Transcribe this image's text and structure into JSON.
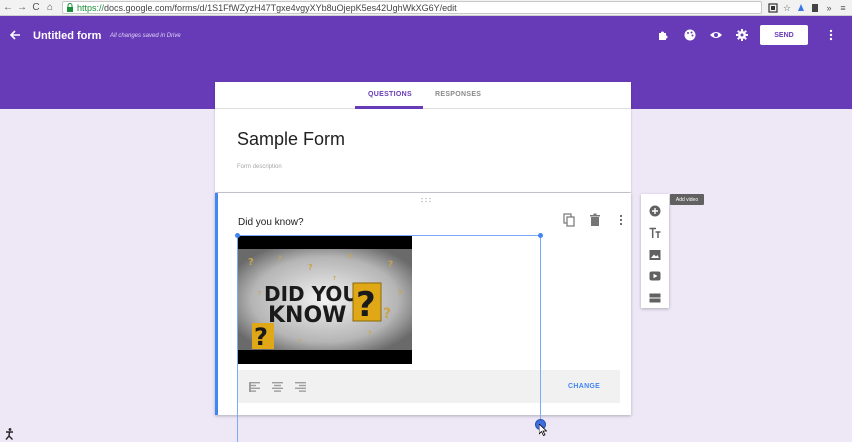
{
  "browser": {
    "url_https": "https://",
    "url_rest": "docs.google.com/forms/d/1S1FfWZyzH47Tgxe4vgyXYb8uOjepK5es42UghWkXG6Y/edit",
    "nav_back": "←",
    "nav_forward": "→",
    "nav_reload": "C",
    "nav_home": "⌂",
    "ext_icons": [
      "screenshot-icon",
      "star-icon",
      "extension-icon",
      "pocket-icon",
      "more-extensions-icon",
      "menu-icon"
    ]
  },
  "header": {
    "title": "Untitled form",
    "saved_note": "All changes saved in Drive",
    "send_label": "SEND",
    "icons": [
      "addon-icon",
      "palette-icon",
      "preview-eye-icon",
      "settings-gear-icon"
    ]
  },
  "tabs": {
    "questions": "QUESTIONS",
    "responses": "RESPONSES",
    "active": "questions"
  },
  "form": {
    "title": "Sample Form",
    "description_placeholder": "Form description"
  },
  "question": {
    "title": "Did you know?",
    "video_text_line1": "DID YOU",
    "video_text_line2": "KNOW",
    "change_label": "CHANGE"
  },
  "side_toolbar": {
    "tooltip": "Add video",
    "items": [
      "add-question-icon",
      "add-title-icon",
      "add-image-icon",
      "add-video-icon",
      "add-section-icon"
    ]
  },
  "colors": {
    "brand": "#673ab7",
    "accent_blue": "#4285f4",
    "background": "#ede7f6"
  }
}
